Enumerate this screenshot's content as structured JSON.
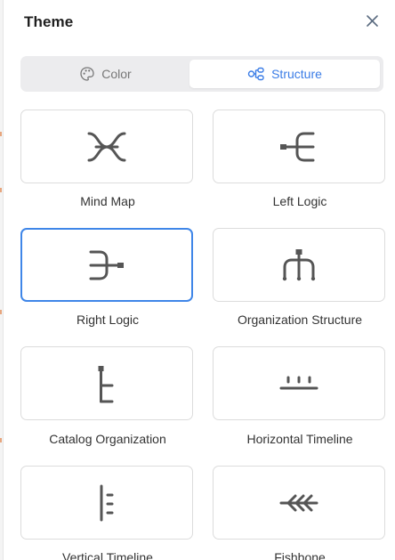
{
  "panel": {
    "title": "Theme",
    "close_icon": "close-icon"
  },
  "tabs": [
    {
      "label": "Color",
      "icon": "palette-icon",
      "active": false
    },
    {
      "label": "Structure",
      "icon": "structure-icon",
      "active": true
    }
  ],
  "colors": {
    "accent": "#3a7ce6",
    "selected_border": "#3f86e8",
    "card_border": "#dcdcdc",
    "tab_bg": "#ececee"
  },
  "structures": [
    {
      "label": "Mind Map",
      "icon": "mind-map-icon",
      "selected": false
    },
    {
      "label": "Left Logic",
      "icon": "left-logic-icon",
      "selected": false
    },
    {
      "label": "Right Logic",
      "icon": "right-logic-icon",
      "selected": true
    },
    {
      "label": "Organization Structure",
      "icon": "organization-structure-icon",
      "selected": false
    },
    {
      "label": "Catalog Organization",
      "icon": "catalog-organization-icon",
      "selected": false
    },
    {
      "label": "Horizontal Timeline",
      "icon": "horizontal-timeline-icon",
      "selected": false
    },
    {
      "label": "Vertical Timeline",
      "icon": "vertical-timeline-icon",
      "selected": false
    },
    {
      "label": "Fishbone",
      "icon": "fishbone-icon",
      "selected": false
    }
  ]
}
